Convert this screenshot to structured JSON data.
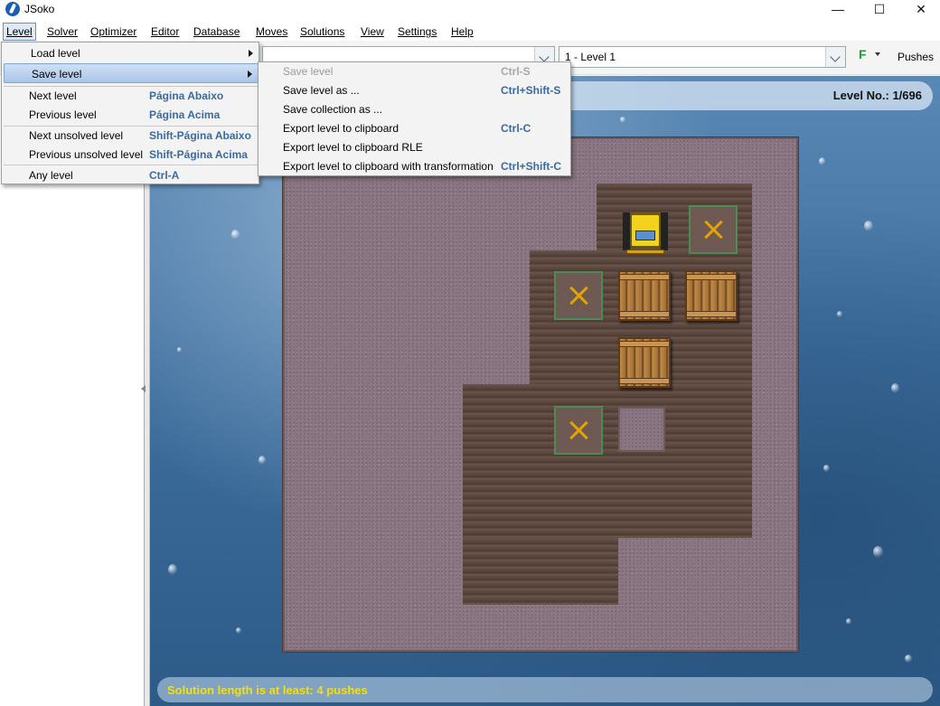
{
  "window": {
    "title": "JSoko",
    "minimize_glyph": "—",
    "maximize_glyph": "☐",
    "close_glyph": "✕"
  },
  "menubar": {
    "items": [
      {
        "label": "Level"
      },
      {
        "label": "Solver"
      },
      {
        "label": "Optimizer"
      },
      {
        "label": "Editor"
      },
      {
        "label": "Database"
      },
      {
        "label": "Moves"
      },
      {
        "label": "Solutions"
      },
      {
        "label": "View"
      },
      {
        "label": "Settings"
      },
      {
        "label": "Help"
      }
    ]
  },
  "toolbar": {
    "level_select_value": "1 - Level 1",
    "solver_button_label": "F",
    "pushes_label": "Pushes"
  },
  "level_menu": {
    "items": [
      {
        "label": "Load level",
        "shortcut": ""
      },
      {
        "label": "Save level",
        "shortcut": ""
      },
      {
        "label": "Next level",
        "shortcut": "Página Abaixo"
      },
      {
        "label": "Previous level",
        "shortcut": "Página Acima"
      },
      {
        "label": "Next unsolved level",
        "shortcut": "Shift-Página Abaixo"
      },
      {
        "label": "Previous unsolved level",
        "shortcut": "Shift-Página Acima"
      },
      {
        "label": "Any level",
        "shortcut": "Ctrl-A"
      }
    ]
  },
  "save_submenu": {
    "items": [
      {
        "label": "Save level",
        "shortcut": "Ctrl-S",
        "enabled": false
      },
      {
        "label": "Save level as ...",
        "shortcut": "Ctrl+Shift-S",
        "enabled": true
      },
      {
        "label": "Save collection as ...",
        "shortcut": "",
        "enabled": true
      },
      {
        "label": "Export level to clipboard",
        "shortcut": "Ctrl-C",
        "enabled": true
      },
      {
        "label": "Export level to clipboard RLE",
        "shortcut": "",
        "enabled": true
      },
      {
        "label": "Export level to clipboard with transformation",
        "shortcut": "Ctrl+Shift-C",
        "enabled": true
      }
    ]
  },
  "game": {
    "level_number_text": "Level No.: 1/696",
    "status_text": "Solution length is at least:  4 pushes"
  },
  "colors": {
    "accent": "#3b6aa0",
    "status_text": "#f5e000",
    "goal_outline": "#4d8a55",
    "goal_mark": "#e2a400"
  }
}
